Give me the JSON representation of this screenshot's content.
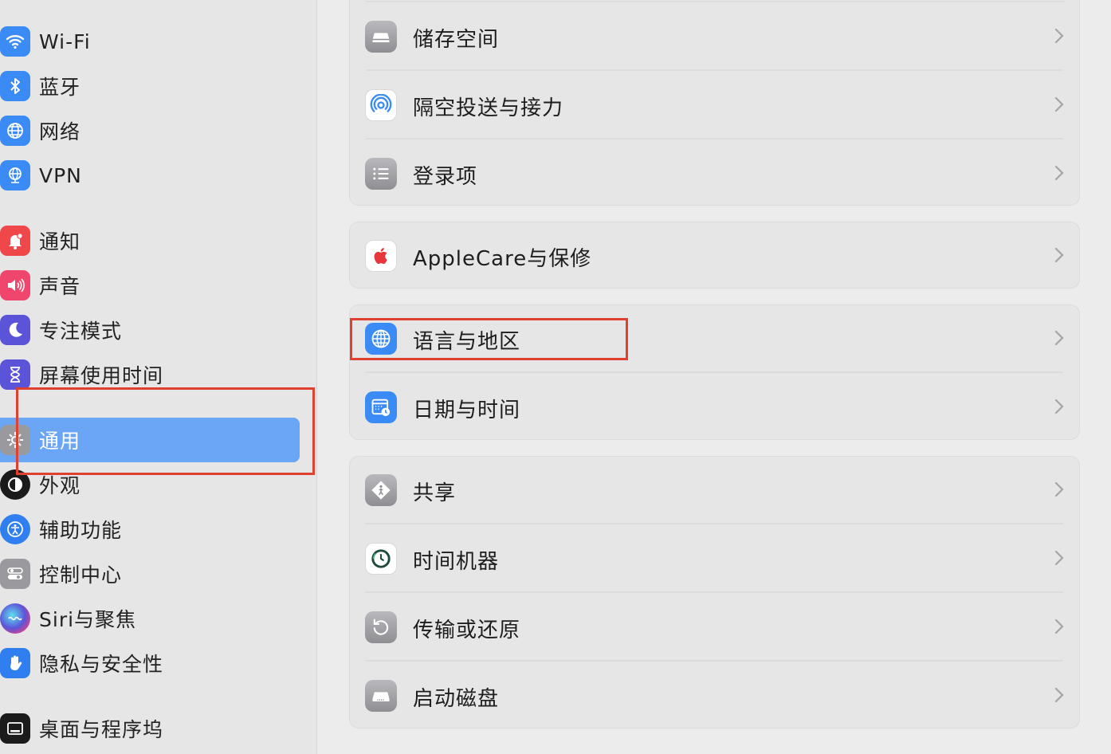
{
  "sidebar": {
    "items": [
      {
        "label": "Wi-Fi",
        "icon": "wifi-icon",
        "color": "#3a8bf5"
      },
      {
        "label": "蓝牙",
        "icon": "bluetooth-icon",
        "color": "#3a8bf5"
      },
      {
        "label": "网络",
        "icon": "globe-icon",
        "color": "#3a8bf5"
      },
      {
        "label": "VPN",
        "icon": "vpn-globe-icon",
        "color": "#3a8bf5"
      },
      {
        "label": "通知",
        "icon": "bell-icon",
        "color": "#f0474b"
      },
      {
        "label": "声音",
        "icon": "speaker-icon",
        "color": "#f0466e"
      },
      {
        "label": "专注模式",
        "icon": "moon-icon",
        "color": "#5b54d8"
      },
      {
        "label": "屏幕使用时间",
        "icon": "hourglass-icon",
        "color": "#5b54d8"
      },
      {
        "label": "通用",
        "icon": "gear-icon",
        "color": "#9a9a9e",
        "selected": true
      },
      {
        "label": "外观",
        "icon": "appearance-icon",
        "color": "#1b1b1b"
      },
      {
        "label": "辅助功能",
        "icon": "accessibility-icon",
        "color": "#2f7ff0"
      },
      {
        "label": "控制中心",
        "icon": "toggles-icon",
        "color": "#9a9a9e"
      },
      {
        "label": "Siri与聚焦",
        "icon": "siri-icon",
        "color": "#222"
      },
      {
        "label": "隐私与安全性",
        "icon": "hand-icon",
        "color": "#2f7ff0"
      },
      {
        "label": "桌面与程序坞",
        "icon": "dock-icon",
        "color": "#1b1b1b"
      }
    ]
  },
  "main": {
    "groups": [
      {
        "rows": [
          {
            "label": "储存空间",
            "icon": "storage-icon"
          },
          {
            "label": "隔空投送与接力",
            "icon": "airdrop-icon"
          },
          {
            "label": "登录项",
            "icon": "list-icon"
          }
        ]
      },
      {
        "rows": [
          {
            "label": "AppleCare与保修",
            "icon": "apple-icon"
          }
        ]
      },
      {
        "rows": [
          {
            "label": "语言与地区",
            "icon": "language-globe-icon"
          },
          {
            "label": "日期与时间",
            "icon": "calendar-clock-icon"
          }
        ]
      },
      {
        "rows": [
          {
            "label": "共享",
            "icon": "sharing-icon"
          },
          {
            "label": "时间机器",
            "icon": "time-machine-icon"
          },
          {
            "label": "传输或还原",
            "icon": "restore-icon"
          },
          {
            "label": "启动磁盘",
            "icon": "disk-icon"
          }
        ]
      }
    ]
  },
  "colors": {
    "highlight": "#e0402f",
    "selection": "#6aa6f5"
  }
}
